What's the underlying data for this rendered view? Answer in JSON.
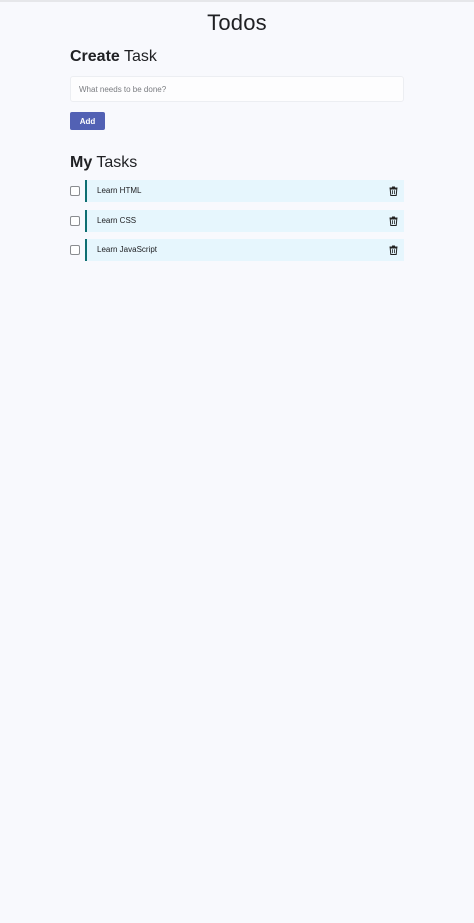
{
  "app": {
    "title": "Todos"
  },
  "create": {
    "heading_strong": "Create",
    "heading_rest": " Task",
    "input_placeholder": "What needs to be done?",
    "input_value": "",
    "add_label": "Add"
  },
  "tasks": {
    "heading_strong": "My",
    "heading_rest": " Tasks",
    "items": [
      {
        "label": "Learn HTML",
        "checked": false
      },
      {
        "label": "Learn CSS",
        "checked": false
      },
      {
        "label": "Learn JavaScript",
        "checked": false
      }
    ]
  },
  "icons": {
    "delete": "trash-icon",
    "checkbox": "checkbox-icon"
  },
  "colors": {
    "background": "#f8f9fd",
    "accent_button": "#5261b4",
    "task_bar": "#0f6f72",
    "task_background": "#e6f6fd"
  }
}
